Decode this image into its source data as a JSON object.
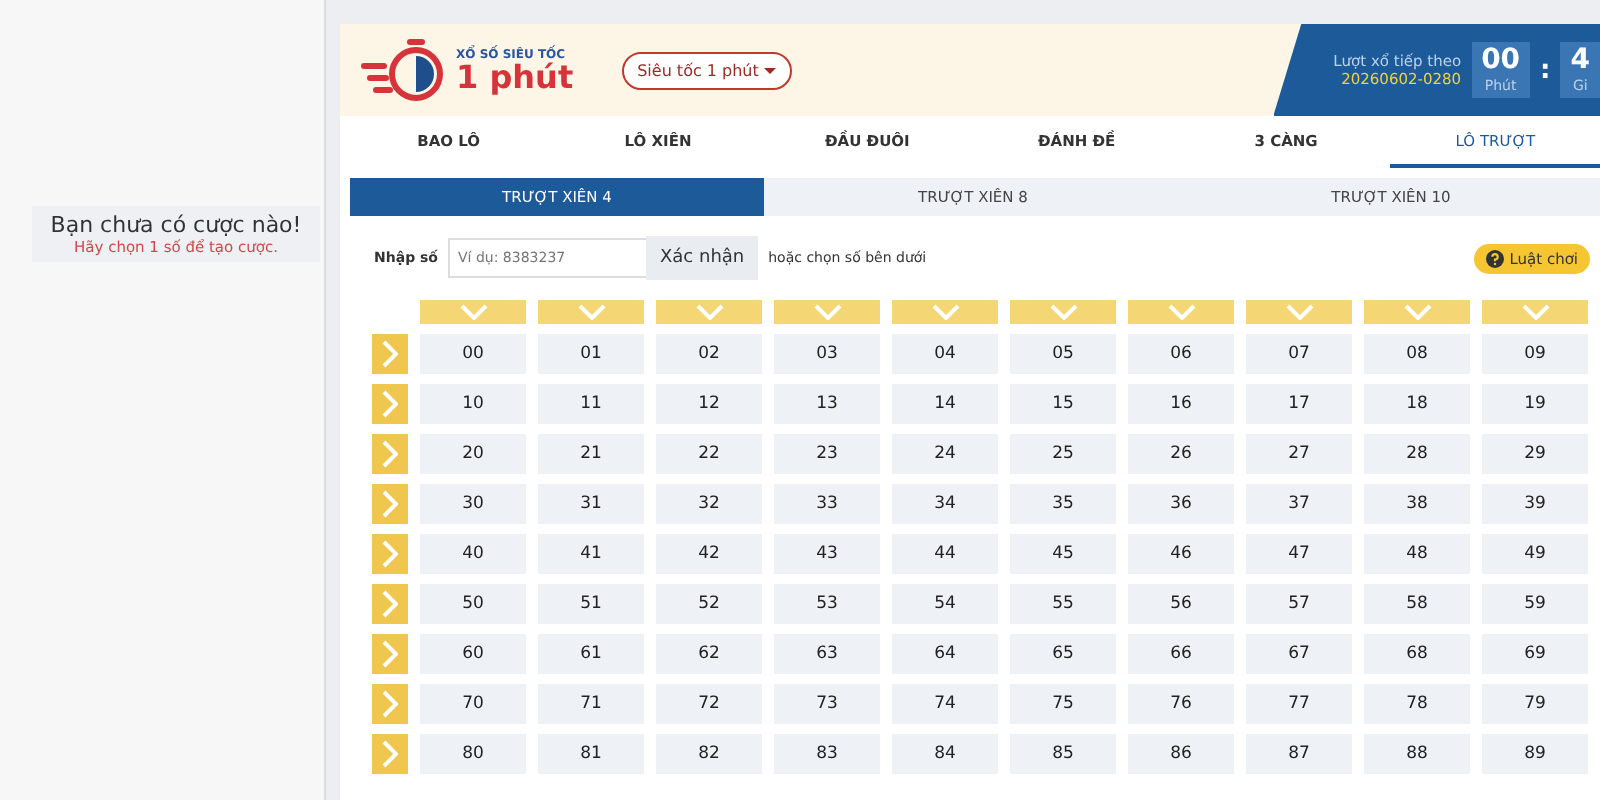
{
  "sidebar": {
    "empty_title": "Bạn chưa có cược nào!",
    "empty_hint": "Hãy chọn 1 số để tạo cược."
  },
  "header": {
    "game_small": "XỔ SỐ SIÊU TỐC",
    "game_big": "1 phút",
    "game_select": "Siêu tốc 1 phút",
    "next_label": "Lượt xổ tiếp theo",
    "next_id": "20260602-0280",
    "timer": [
      {
        "value": "00",
        "unit": "Phút"
      },
      {
        "value": "4",
        "unit": "Gi"
      }
    ],
    "timer_sep": ":"
  },
  "tabs": [
    {
      "label": "BAO LÔ",
      "selected": false
    },
    {
      "label": "LÔ XIÊN",
      "selected": false
    },
    {
      "label": "ĐẦU ĐUÔI",
      "selected": false
    },
    {
      "label": "ĐÁNH ĐỀ",
      "selected": false
    },
    {
      "label": "3 CÀNG",
      "selected": false
    },
    {
      "label": "LÔ TRƯỢT",
      "selected": true
    }
  ],
  "subtabs": [
    {
      "label": "TRƯỢT XIÊN 4",
      "selected": true
    },
    {
      "label": "TRƯỢT XIÊN 8",
      "selected": false
    },
    {
      "label": "TRƯỢT XIÊN 10",
      "selected": false
    }
  ],
  "input": {
    "label": "Nhập số",
    "placeholder": "Ví dụ: 8383237",
    "button": "Xác nhận",
    "hint": "hoặc chọn số bên dưới",
    "rules_button": "Luật chơi"
  },
  "grid": {
    "rows": [
      [
        "00",
        "01",
        "02",
        "03",
        "04",
        "05",
        "06",
        "07",
        "08",
        "09"
      ],
      [
        "10",
        "11",
        "12",
        "13",
        "14",
        "15",
        "16",
        "17",
        "18",
        "19"
      ],
      [
        "20",
        "21",
        "22",
        "23",
        "24",
        "25",
        "26",
        "27",
        "28",
        "29"
      ],
      [
        "30",
        "31",
        "32",
        "33",
        "34",
        "35",
        "36",
        "37",
        "38",
        "39"
      ],
      [
        "40",
        "41",
        "42",
        "43",
        "44",
        "45",
        "46",
        "47",
        "48",
        "49"
      ],
      [
        "50",
        "51",
        "52",
        "53",
        "54",
        "55",
        "56",
        "57",
        "58",
        "59"
      ],
      [
        "60",
        "61",
        "62",
        "63",
        "64",
        "65",
        "66",
        "67",
        "68",
        "69"
      ],
      [
        "70",
        "71",
        "72",
        "73",
        "74",
        "75",
        "76",
        "77",
        "78",
        "79"
      ],
      [
        "80",
        "81",
        "82",
        "83",
        "84",
        "85",
        "86",
        "87",
        "88",
        "89"
      ]
    ]
  }
}
